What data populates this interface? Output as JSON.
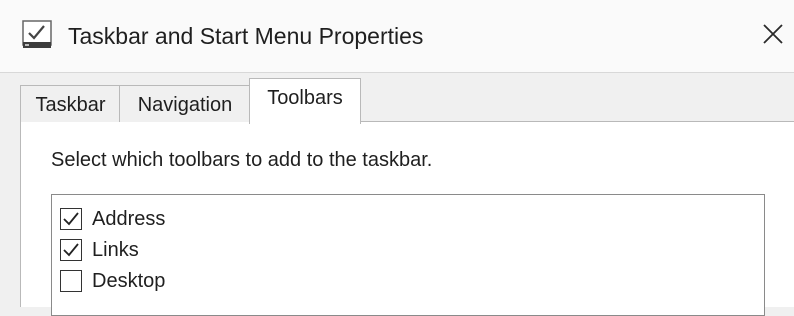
{
  "window": {
    "title": "Taskbar and Start Menu Properties",
    "icon": "taskbar-properties-icon",
    "close_icon": "close-icon"
  },
  "tabs": [
    {
      "label": "Taskbar",
      "active": false
    },
    {
      "label": "Navigation",
      "active": false
    },
    {
      "label": "Toolbars",
      "active": true
    }
  ],
  "toolbars_tab": {
    "instruction": "Select which toolbars to add to the taskbar.",
    "items": [
      {
        "label": "Address",
        "checked": true
      },
      {
        "label": "Links",
        "checked": true
      },
      {
        "label": "Desktop",
        "checked": false
      }
    ]
  }
}
